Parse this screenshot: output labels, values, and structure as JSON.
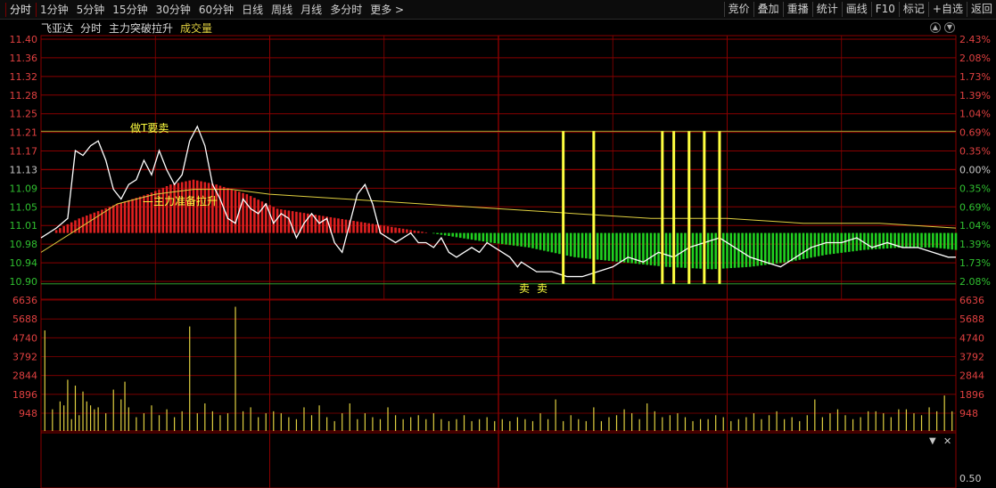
{
  "toolbar": {
    "tabs": [
      "分时",
      "1分钟",
      "5分钟",
      "15分钟",
      "30分钟",
      "60分钟",
      "日线",
      "周线",
      "月线",
      "多分时",
      "更多 >"
    ],
    "right": [
      "竞价",
      "叠加",
      "重播",
      "统计",
      "画线",
      "F10",
      "标记",
      "+自选",
      "返回"
    ]
  },
  "header": {
    "stock": "飞亚达",
    "period": "分时",
    "indicator": "主力突破拉升",
    "volume_label": "成交量"
  },
  "annotations": {
    "sell_t": "做T要卖",
    "pull_up": "主力准备拉升",
    "sell_1": "卖",
    "sell_2": "卖"
  },
  "colors": {
    "up": "#e02020",
    "down": "#20d020",
    "price": "#ffffff",
    "avg": "#e0d040",
    "grid": "#8a0000",
    "signal": "#ffff40"
  },
  "price_axis": {
    "left": [
      "11.40",
      "11.36",
      "11.32",
      "11.28",
      "11.25",
      "11.21",
      "11.17",
      "11.13",
      "11.09",
      "11.05",
      "11.01",
      "10.98",
      "10.94",
      "10.90"
    ],
    "right": [
      "2.43%",
      "2.08%",
      "1.73%",
      "1.39%",
      "1.04%",
      "0.69%",
      "0.35%",
      "0.00%",
      "0.35%",
      "0.69%",
      "1.04%",
      "1.39%",
      "1.73%",
      "2.08%"
    ]
  },
  "volume_axis": [
    "6636",
    "5688",
    "4740",
    "3792",
    "2844",
    "1896",
    "948"
  ],
  "lower_axis": [
    "0.50"
  ],
  "chart_data": {
    "type": "line",
    "x_range": [
      0,
      240
    ],
    "price": {
      "ylim": [
        10.88,
        11.4
      ],
      "prev_close": 11.13,
      "price_line": [
        [
          0,
          10.99
        ],
        [
          4,
          11.01
        ],
        [
          7,
          11.03
        ],
        [
          9,
          11.17
        ],
        [
          11,
          11.16
        ],
        [
          13,
          11.18
        ],
        [
          15,
          11.19
        ],
        [
          17,
          11.15
        ],
        [
          19,
          11.09
        ],
        [
          21,
          11.07
        ],
        [
          23,
          11.1
        ],
        [
          25,
          11.11
        ],
        [
          27,
          11.15
        ],
        [
          29,
          11.12
        ],
        [
          31,
          11.17
        ],
        [
          33,
          11.13
        ],
        [
          35,
          11.1
        ],
        [
          37,
          11.12
        ],
        [
          39,
          11.19
        ],
        [
          41,
          11.22
        ],
        [
          43,
          11.18
        ],
        [
          45,
          11.1
        ],
        [
          47,
          11.07
        ],
        [
          49,
          11.03
        ],
        [
          51,
          11.02
        ],
        [
          53,
          11.07
        ],
        [
          55,
          11.05
        ],
        [
          57,
          11.04
        ],
        [
          59,
          11.06
        ],
        [
          61,
          11.02
        ],
        [
          63,
          11.04
        ],
        [
          65,
          11.03
        ],
        [
          67,
          10.99
        ],
        [
          69,
          11.02
        ],
        [
          71,
          11.04
        ],
        [
          73,
          11.02
        ],
        [
          75,
          11.03
        ],
        [
          77,
          10.98
        ],
        [
          79,
          10.96
        ],
        [
          81,
          11.02
        ],
        [
          83,
          11.08
        ],
        [
          85,
          11.1
        ],
        [
          87,
          11.06
        ],
        [
          89,
          11.0
        ],
        [
          91,
          10.99
        ],
        [
          93,
          10.98
        ],
        [
          95,
          10.99
        ],
        [
          97,
          11.0
        ],
        [
          99,
          10.98
        ],
        [
          101,
          10.98
        ],
        [
          103,
          10.97
        ],
        [
          105,
          10.99
        ],
        [
          107,
          10.96
        ],
        [
          109,
          10.95
        ],
        [
          111,
          10.96
        ],
        [
          113,
          10.97
        ],
        [
          115,
          10.96
        ],
        [
          117,
          10.98
        ],
        [
          119,
          10.97
        ],
        [
          121,
          10.96
        ],
        [
          123,
          10.95
        ],
        [
          125,
          10.93
        ],
        [
          127,
          10.94
        ],
        [
          129,
          10.95
        ],
        [
          131,
          10.93
        ],
        [
          133,
          10.93
        ],
        [
          135,
          10.92
        ],
        [
          137,
          10.93
        ],
        [
          139,
          10.93
        ],
        [
          141,
          10.92
        ],
        [
          143,
          10.93
        ],
        [
          145,
          10.94
        ],
        [
          147,
          10.92
        ],
        [
          149,
          10.92
        ],
        [
          151,
          10.93
        ],
        [
          153,
          10.92
        ],
        [
          155,
          10.92
        ],
        [
          157,
          10.93
        ],
        [
          159,
          10.93
        ],
        [
          161,
          10.92
        ],
        [
          163,
          10.93
        ],
        [
          165,
          10.92
        ],
        [
          167,
          10.93
        ],
        [
          169,
          10.93
        ],
        [
          171,
          10.92
        ],
        [
          173,
          10.91
        ],
        [
          175,
          10.93
        ],
        [
          177,
          10.92
        ],
        [
          179,
          10.9
        ],
        [
          181,
          10.92
        ],
        [
          183,
          10.91
        ],
        [
          185,
          10.91
        ],
        [
          187,
          10.92
        ],
        [
          189,
          10.92
        ],
        [
          191,
          10.93
        ],
        [
          193,
          10.92
        ],
        [
          195,
          10.9
        ],
        [
          197,
          10.91
        ],
        [
          199,
          10.92
        ],
        [
          201,
          10.91
        ],
        [
          203,
          10.92
        ],
        [
          205,
          10.92
        ],
        [
          207,
          10.93
        ],
        [
          209,
          10.91
        ],
        [
          211,
          10.9
        ],
        [
          213,
          10.91
        ],
        [
          215,
          10.9
        ],
        [
          217,
          10.91
        ],
        [
          219,
          10.92
        ],
        [
          221,
          10.91
        ],
        [
          223,
          10.9
        ],
        [
          225,
          10.91
        ],
        [
          227,
          10.92
        ],
        [
          229,
          10.91
        ],
        [
          231,
          10.9
        ]
      ],
      "price_line_pm": [
        [
          126,
          10.94
        ],
        [
          130,
          10.92
        ],
        [
          134,
          10.92
        ],
        [
          138,
          10.91
        ],
        [
          142,
          10.91
        ],
        [
          146,
          10.92
        ],
        [
          150,
          10.93
        ],
        [
          154,
          10.95
        ],
        [
          158,
          10.94
        ],
        [
          162,
          10.96
        ],
        [
          166,
          10.95
        ],
        [
          170,
          10.97
        ],
        [
          174,
          10.98
        ],
        [
          178,
          10.99
        ],
        [
          182,
          10.97
        ],
        [
          186,
          10.95
        ],
        [
          190,
          10.94
        ],
        [
          194,
          10.93
        ],
        [
          198,
          10.95
        ],
        [
          202,
          10.97
        ],
        [
          206,
          10.98
        ],
        [
          210,
          10.98
        ],
        [
          214,
          10.99
        ],
        [
          218,
          10.97
        ],
        [
          222,
          10.98
        ],
        [
          226,
          10.97
        ],
        [
          230,
          10.97
        ],
        [
          234,
          10.96
        ],
        [
          238,
          10.95
        ],
        [
          240,
          10.95
        ]
      ],
      "avg_line": [
        [
          0,
          10.96
        ],
        [
          10,
          11.01
        ],
        [
          20,
          11.06
        ],
        [
          30,
          11.08
        ],
        [
          40,
          11.09
        ],
        [
          50,
          11.09
        ],
        [
          60,
          11.08
        ],
        [
          80,
          11.07
        ],
        [
          100,
          11.06
        ],
        [
          120,
          11.05
        ],
        [
          140,
          11.04
        ],
        [
          160,
          11.03
        ],
        [
          180,
          11.03
        ],
        [
          200,
          11.02
        ],
        [
          220,
          11.02
        ],
        [
          240,
          11.01
        ]
      ],
      "resistance": 11.21,
      "support": 10.895,
      "main_force": [
        [
          0,
          10.99
        ],
        [
          10,
          11.03
        ],
        [
          20,
          11.06
        ],
        [
          28,
          11.08
        ],
        [
          34,
          11.1
        ],
        [
          40,
          11.11
        ],
        [
          46,
          11.1
        ],
        [
          54,
          11.08
        ],
        [
          62,
          11.05
        ],
        [
          70,
          11.04
        ],
        [
          78,
          11.03
        ],
        [
          86,
          11.02
        ],
        [
          94,
          11.01
        ],
        [
          102,
          11.0
        ],
        [
          110,
          10.99
        ],
        [
          118,
          10.98
        ],
        [
          128,
          10.97
        ],
        [
          140,
          10.95
        ],
        [
          152,
          10.94
        ],
        [
          164,
          10.93
        ],
        [
          176,
          10.925
        ],
        [
          186,
          10.93
        ],
        [
          196,
          10.94
        ],
        [
          206,
          10.955
        ],
        [
          216,
          10.965
        ],
        [
          226,
          10.97
        ],
        [
          234,
          10.97
        ],
        [
          240,
          10.965
        ]
      ],
      "baseline": 11.0,
      "signals_x": [
        137,
        145,
        163,
        166,
        170,
        174,
        178
      ]
    },
    "volume": {
      "ylim": [
        0,
        7200
      ],
      "bars": [
        [
          1,
          5100
        ],
        [
          3,
          1100
        ],
        [
          5,
          1500
        ],
        [
          6,
          1300
        ],
        [
          7,
          2600
        ],
        [
          8,
          600
        ],
        [
          9,
          2300
        ],
        [
          10,
          800
        ],
        [
          11,
          2000
        ],
        [
          12,
          1500
        ],
        [
          13,
          1300
        ],
        [
          14,
          1100
        ],
        [
          15,
          1200
        ],
        [
          17,
          900
        ],
        [
          19,
          2100
        ],
        [
          21,
          1600
        ],
        [
          22,
          2500
        ],
        [
          23,
          1200
        ],
        [
          25,
          700
        ],
        [
          27,
          900
        ],
        [
          29,
          1300
        ],
        [
          31,
          800
        ],
        [
          33,
          1100
        ],
        [
          35,
          700
        ],
        [
          37,
          1000
        ],
        [
          39,
          5300
        ],
        [
          41,
          900
        ],
        [
          43,
          1400
        ],
        [
          45,
          1000
        ],
        [
          47,
          800
        ],
        [
          49,
          900
        ],
        [
          51,
          6300
        ],
        [
          53,
          1000
        ],
        [
          55,
          1200
        ],
        [
          57,
          700
        ],
        [
          59,
          900
        ],
        [
          61,
          1000
        ],
        [
          63,
          900
        ],
        [
          65,
          700
        ],
        [
          67,
          600
        ],
        [
          69,
          1200
        ],
        [
          71,
          800
        ],
        [
          73,
          1300
        ],
        [
          75,
          700
        ],
        [
          77,
          500
        ],
        [
          79,
          900
        ],
        [
          81,
          1400
        ],
        [
          83,
          600
        ],
        [
          85,
          900
        ],
        [
          87,
          700
        ],
        [
          89,
          600
        ],
        [
          91,
          1200
        ],
        [
          93,
          800
        ],
        [
          95,
          600
        ],
        [
          97,
          700
        ],
        [
          99,
          800
        ],
        [
          101,
          600
        ],
        [
          103,
          900
        ],
        [
          105,
          600
        ],
        [
          107,
          500
        ],
        [
          109,
          600
        ],
        [
          111,
          800
        ],
        [
          113,
          500
        ],
        [
          115,
          600
        ],
        [
          117,
          700
        ],
        [
          119,
          500
        ],
        [
          121,
          600
        ],
        [
          123,
          500
        ],
        [
          125,
          700
        ],
        [
          127,
          600
        ],
        [
          129,
          500
        ],
        [
          131,
          900
        ],
        [
          133,
          600
        ],
        [
          135,
          1600
        ],
        [
          137,
          500
        ],
        [
          139,
          800
        ],
        [
          141,
          600
        ],
        [
          143,
          500
        ],
        [
          145,
          1200
        ],
        [
          147,
          500
        ],
        [
          149,
          700
        ],
        [
          151,
          800
        ],
        [
          153,
          1100
        ],
        [
          155,
          900
        ],
        [
          157,
          600
        ],
        [
          159,
          1400
        ],
        [
          161,
          1000
        ],
        [
          163,
          700
        ],
        [
          165,
          800
        ],
        [
          167,
          900
        ],
        [
          169,
          700
        ],
        [
          171,
          500
        ],
        [
          173,
          600
        ],
        [
          175,
          600
        ],
        [
          177,
          800
        ],
        [
          179,
          700
        ],
        [
          181,
          500
        ],
        [
          183,
          600
        ],
        [
          185,
          700
        ],
        [
          187,
          900
        ],
        [
          189,
          600
        ],
        [
          191,
          800
        ],
        [
          193,
          1000
        ],
        [
          195,
          600
        ],
        [
          197,
          700
        ],
        [
          199,
          500
        ],
        [
          201,
          800
        ],
        [
          203,
          1600
        ],
        [
          205,
          700
        ],
        [
          207,
          900
        ],
        [
          209,
          1100
        ],
        [
          211,
          800
        ],
        [
          213,
          600
        ],
        [
          215,
          700
        ],
        [
          217,
          1000
        ],
        [
          219,
          1000
        ],
        [
          221,
          900
        ],
        [
          223,
          700
        ],
        [
          225,
          1100
        ],
        [
          227,
          1100
        ],
        [
          229,
          900
        ],
        [
          231,
          800
        ],
        [
          233,
          1200
        ],
        [
          235,
          1000
        ],
        [
          237,
          1800
        ],
        [
          239,
          1000
        ]
      ]
    }
  }
}
